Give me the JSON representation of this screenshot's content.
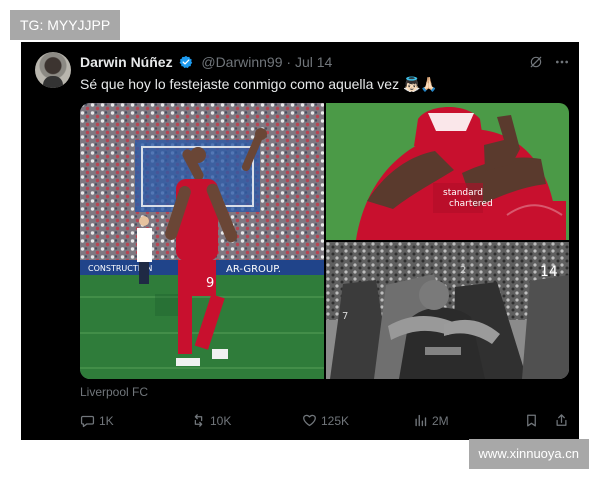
{
  "watermarks": {
    "top": "TG: MYYJJPP",
    "bottom": "www.xinnuoya.cn"
  },
  "tweet": {
    "display_name": "Darwin Núñez",
    "handle": "@Darwinn99",
    "date": "Jul 14",
    "text": "Sé que hoy lo festejaste conmigo como aquella vez 👼🏻🙏🏻",
    "source": "Liverpool FC",
    "icons": {
      "verified": "verified-badge-icon",
      "grok": "grok-icon",
      "more": "more-options-icon"
    },
    "stats": {
      "replies": "1K",
      "reposts": "10K",
      "likes": "125K",
      "views": "2M"
    },
    "colors": {
      "background": "#000000",
      "primary_text": "#e7e9ea",
      "secondary_text": "#71767b",
      "verified": "#1d9bf0",
      "kit_red": "#c8102e"
    }
  }
}
